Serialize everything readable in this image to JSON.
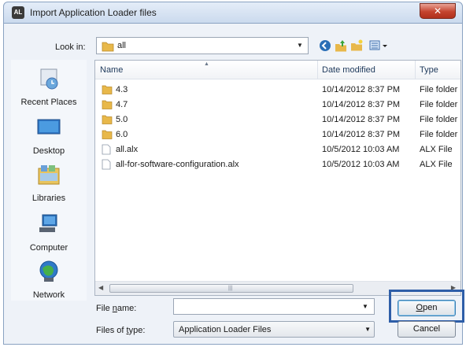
{
  "window": {
    "title": "Import Application Loader files",
    "app_icon_text": "AL",
    "close_symbol": "✕"
  },
  "toolbar": {
    "look_in_label": "Look in:",
    "look_in_value": "all",
    "icons": [
      "back-icon",
      "up-folder-icon",
      "new-folder-icon",
      "views-menu-icon"
    ]
  },
  "places": [
    {
      "label": "Recent Places",
      "icon": "recent-places-icon"
    },
    {
      "label": "Desktop",
      "icon": "desktop-icon"
    },
    {
      "label": "Libraries",
      "icon": "libraries-icon"
    },
    {
      "label": "Computer",
      "icon": "computer-icon"
    },
    {
      "label": "Network",
      "icon": "network-icon"
    }
  ],
  "file_list": {
    "columns": [
      "Name",
      "Date modified",
      "Type"
    ],
    "rows": [
      {
        "name": "4.3",
        "date": "10/14/2012 8:37 PM",
        "type": "File folder",
        "kind": "folder"
      },
      {
        "name": "4.7",
        "date": "10/14/2012 8:37 PM",
        "type": "File folder",
        "kind": "folder"
      },
      {
        "name": "5.0",
        "date": "10/14/2012 8:37 PM",
        "type": "File folder",
        "kind": "folder"
      },
      {
        "name": "6.0",
        "date": "10/14/2012 8:37 PM",
        "type": "File folder",
        "kind": "folder"
      },
      {
        "name": "all.alx",
        "date": "10/5/2012 10:03 AM",
        "type": "ALX File",
        "kind": "file"
      },
      {
        "name": "all-for-software-configuration.alx",
        "date": "10/5/2012 10:03 AM",
        "type": "ALX File",
        "kind": "file"
      }
    ]
  },
  "bottom": {
    "file_name_label_pre": "File ",
    "file_name_label_key": "n",
    "file_name_label_post": "ame:",
    "file_name_value": "",
    "file_type_label_pre": "Files of ",
    "file_type_label_key": "t",
    "file_type_label_post": "ype:",
    "file_type_value": "Application Loader Files",
    "open_key": "O",
    "open_rest": "pen",
    "cancel_label": "Cancel"
  },
  "colors": {
    "highlight": "#2e5ea8",
    "folder": "#e8b84a"
  }
}
